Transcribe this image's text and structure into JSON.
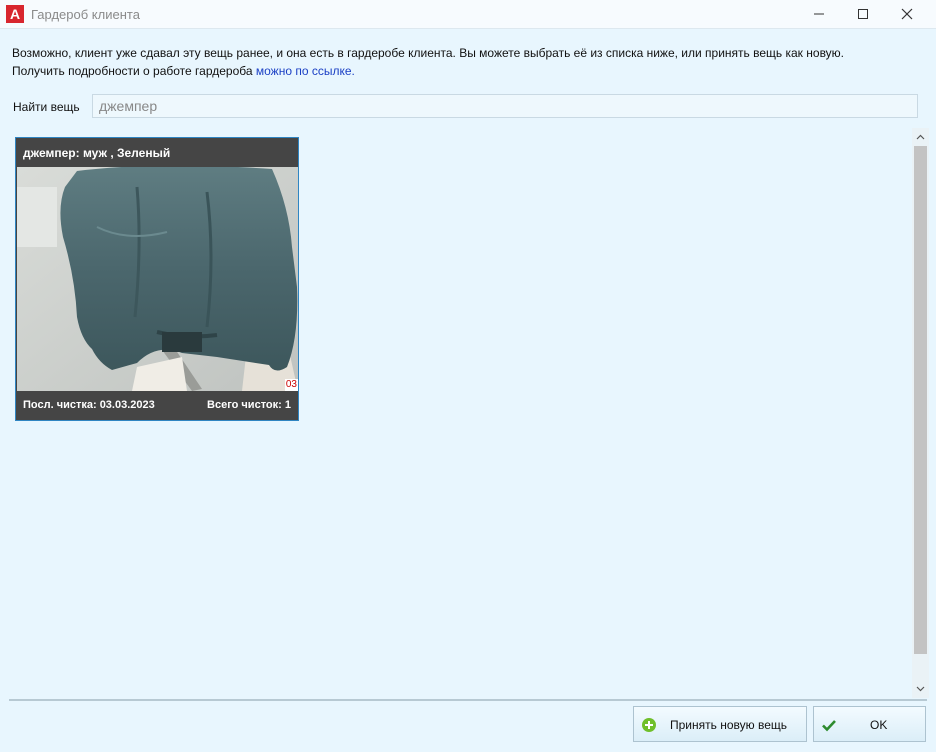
{
  "window": {
    "title": "Гардероб клиента",
    "app_icon_letter": "A"
  },
  "info": {
    "line1": "Возможно, клиент уже сдавал эту вещь ранее, и она есть в гардеробе клиента. Вы можете выбрать её из списка ниже, или принять вещь как новую.",
    "line2_prefix": "Получить подробности о работе гардероба ",
    "line2_link": "можно по ссылке."
  },
  "search": {
    "label": "Найти вещь",
    "value": "джемпер"
  },
  "items": [
    {
      "title": "джемпер: муж , Зеленый",
      "photo_tag": "03",
      "last_cleaning": "Посл. чистка: 03.03.2023",
      "total_cleanings": "Всего чисток: 1"
    }
  ],
  "buttons": {
    "accept_new": "Принять новую вещь",
    "ok": "OK"
  },
  "colors": {
    "background": "#e8f6fe",
    "card_bg": "#454545",
    "card_border": "#2f85c2",
    "link": "#1a3fc4",
    "app_icon": "#d8262e"
  },
  "icons": {
    "accept_new": "plus-circle-icon",
    "ok": "checkmark-icon"
  }
}
